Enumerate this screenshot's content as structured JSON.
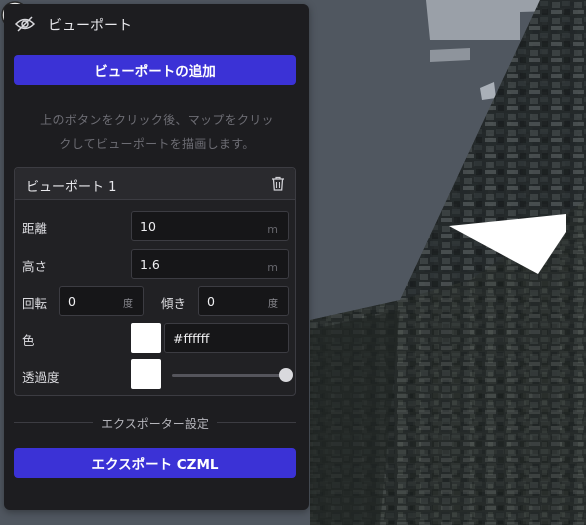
{
  "panel": {
    "title": "ビューポート",
    "add_button_label": "ビューポートの追加",
    "hint_line1": "上のボタンをクリック後、マップをクリッ",
    "hint_line2": "クしてビューポートを描画します。",
    "viewport_card": {
      "title": "ビューポート 1",
      "distance_label": "距離",
      "distance_value": "10",
      "distance_unit": "m",
      "height_label": "高さ",
      "height_value": "1.6",
      "height_unit": "m",
      "rotation_label": "回転",
      "rotation_value": "0",
      "rotation_unit": "度",
      "tilt_label": "傾き",
      "tilt_value": "0",
      "tilt_unit": "度",
      "color_label": "色",
      "color_value": "#ffffff",
      "opacity_label": "透過度",
      "opacity_level": 1.0
    },
    "export_section_label": "エクスポーター設定",
    "export_button_label": "エクスポート CZML"
  },
  "colors": {
    "accent": "#3b32d6",
    "panel_bg": "#1d1d20",
    "swatch": "#ffffff"
  },
  "icons": {
    "header": "eye-slash-icon",
    "card_delete": "trash-icon",
    "map_marker": "viewport-eye-icon"
  }
}
